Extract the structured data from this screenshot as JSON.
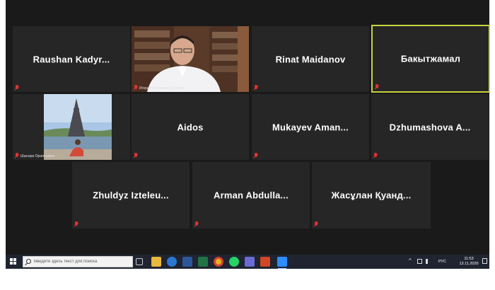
{
  "meeting": {
    "participants": [
      {
        "name": "Raushan  Kadyr...",
        "muted": true
      },
      {
        "caption": "Игорь Николаевич Дубинец",
        "muted": true,
        "video": true
      },
      {
        "name": "Rinat  Maidanov",
        "muted": true
      },
      {
        "name": "Бакытжамал",
        "muted": true,
        "active_speaker": true
      },
      {
        "caption": "Шынара Оралгазина",
        "muted": true,
        "video": true
      },
      {
        "name": "Aidos",
        "muted": true
      },
      {
        "name": "Mukayev  Aman...",
        "muted": true
      },
      {
        "name": "Dzhumashova  A...",
        "muted": true
      },
      {
        "name": "Zhuldyz  Izteleu...",
        "muted": true
      },
      {
        "name": "Arman  Abdulla...",
        "muted": true
      },
      {
        "name": "Жасұлан  Қуанд...",
        "muted": true
      }
    ],
    "colors": {
      "background": "#1a1a1a",
      "tile": "#262626",
      "active_border": "#c7d33f",
      "muted_icon": "#dd3333"
    }
  },
  "taskbar": {
    "search_placeholder": "Введите здесь текст для поиска",
    "apps": [
      "task-view-icon",
      "file-explorer-icon",
      "edge-icon",
      "word-icon",
      "excel-icon",
      "chrome-icon",
      "whatsapp-icon",
      "store-icon",
      "powerpoint-icon",
      "zoom-icon"
    ],
    "tray": {
      "language": "РУС",
      "time": "11:53",
      "date": "13.11.2020"
    }
  }
}
